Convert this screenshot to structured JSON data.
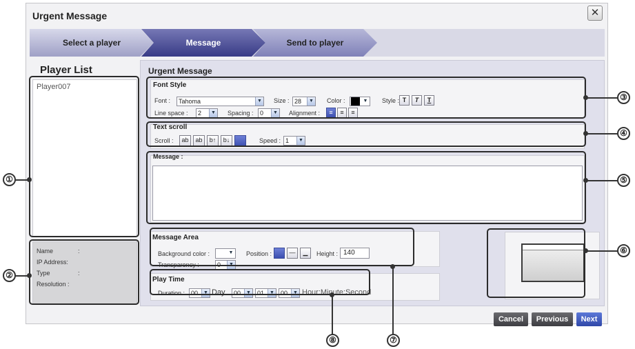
{
  "dialog": {
    "title": "Urgent Message",
    "close_icon": "close-icon"
  },
  "steps": [
    "Select a player",
    "Message",
    "Send to player"
  ],
  "left_panel": {
    "title": "Player List",
    "players": [
      "Player007"
    ],
    "info": [
      {
        "label": "Name",
        "colon": ":"
      },
      {
        "label": "IP Address:",
        "colon": ""
      },
      {
        "label": "Type",
        "colon": ":"
      },
      {
        "label": "Resolution :",
        "colon": ""
      }
    ]
  },
  "main": {
    "title": "Urgent Message",
    "font_style": {
      "title": "Font Style",
      "font_label": "Font :",
      "font_value": "Tahoma",
      "size_label": "Size :",
      "size_value": "28",
      "color_label": "Color :",
      "color_value": "#000000",
      "style_label": "Style :",
      "style_buttons": [
        "T",
        "T",
        "T"
      ],
      "line_space_label": "Line space :",
      "line_space_value": "2",
      "spacing_label": "Spacing :",
      "spacing_value": "0",
      "alignment_label": "Alignment :"
    },
    "text_scroll": {
      "title": "Text scroll",
      "scroll_label": "Scroll :",
      "scroll_buttons": [
        "ab",
        "ab",
        "b↑",
        "b↓"
      ],
      "speed_label": "Speed :",
      "speed_value": "1"
    },
    "message": {
      "label": "Message :"
    },
    "message_area": {
      "title": "Message Area",
      "bg_color_label": "Background color :",
      "position_label": "Position :",
      "height_label": "Height :",
      "height_value": "140",
      "transparency_label": "Transparency :",
      "transparency_value": "0"
    },
    "play_time": {
      "title": "Play Time",
      "duration_label": "Duration :",
      "day_value": "00",
      "day_label": "Day",
      "hour_value": "00",
      "minute_value": "01",
      "second_value": "00",
      "unit_label": "Hour:Minute:Second"
    }
  },
  "buttons": {
    "cancel": "Cancel",
    "previous": "Previous",
    "next": "Next"
  },
  "callouts": [
    "①",
    "②",
    "③",
    "④",
    "⑤",
    "⑥",
    "⑦",
    "⑧"
  ],
  "colors": {
    "accent": "#383b86",
    "primary_button": "#2f47a8",
    "dark_button": "#4a4a4e"
  }
}
